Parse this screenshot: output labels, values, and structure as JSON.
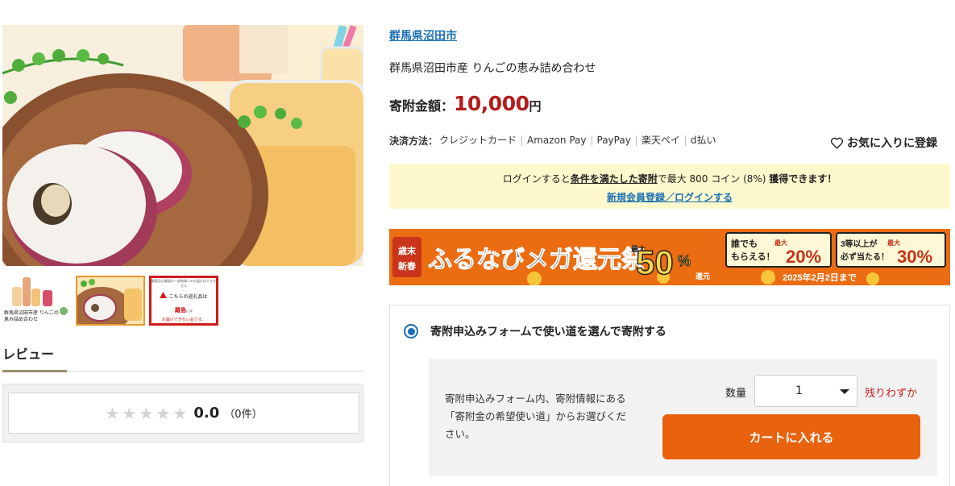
{
  "product": {
    "municipality": "群馬県沼田市",
    "name": "群馬県沼田市産 りんごの恵み詰め合わせ",
    "price_label": "寄附金額：",
    "price_value": "10,000",
    "price_unit": "円"
  },
  "thumbnails": [
    {
      "caption": "群馬県沼田市産 りんごの恵み詰め合わせ"
    },
    {
      "caption": ""
    },
    {
      "line1": "離島及び離島の一部地域へのお届けはできません",
      "line2": "こちらの返礼品は",
      "line3": "離島",
      "line4_suffix": "には",
      "line5": "お届けできない品です。"
    }
  ],
  "payment": {
    "label": "決済方法：",
    "methods": [
      "クレジットカード",
      "Amazon Pay",
      "PayPay",
      "楽天ペイ",
      "d払い"
    ]
  },
  "favorite": {
    "label": "お気に入りに登録",
    "icon": "heart-icon"
  },
  "login_notice": {
    "prefix": "ログインすると",
    "conditions": "条件を満たした寄附",
    "middle": "で最大 800 コイン (8%)",
    "suffix": "獲得できます！",
    "link": "新規会員登録／ログインする"
  },
  "banner": {
    "badge_top": "歳末",
    "badge_bottom": "新春",
    "title": "ふるなびメガ還元祭",
    "max_label": "最大",
    "percent": "50",
    "percent_sign": "%",
    "return_label": "還元",
    "box1_line1": "誰でも",
    "box1_line2": "もらえる！",
    "box1_max": "最大",
    "box1_percent": "20%",
    "box2_line1": "3等以上が",
    "box2_line2": "必ず当たる！",
    "box2_max": "最大",
    "box2_percent": "30%",
    "deadline": "2025年2月2日まで"
  },
  "review": {
    "heading": "レビュー",
    "score": "0.0",
    "count": "（0件）",
    "stars_filled": 0,
    "stars_total": 5
  },
  "donation_form": {
    "option_label": "寄附申込みフォームで使い道を選んで寄附する",
    "description": "寄附申込みフォーム内、寄附情報にある「寄附金の希望使い道」からお選びください。",
    "quantity_label": "数量",
    "quantity_value": "1",
    "stock_label": "残りわずか",
    "cart_button": "カートに入れる"
  },
  "colors": {
    "link": "#1a6fb5",
    "price": "#b41c1c",
    "cart_button": "#e9620e",
    "login_box": "#fdf9cc",
    "stock": "#c81e1e"
  }
}
